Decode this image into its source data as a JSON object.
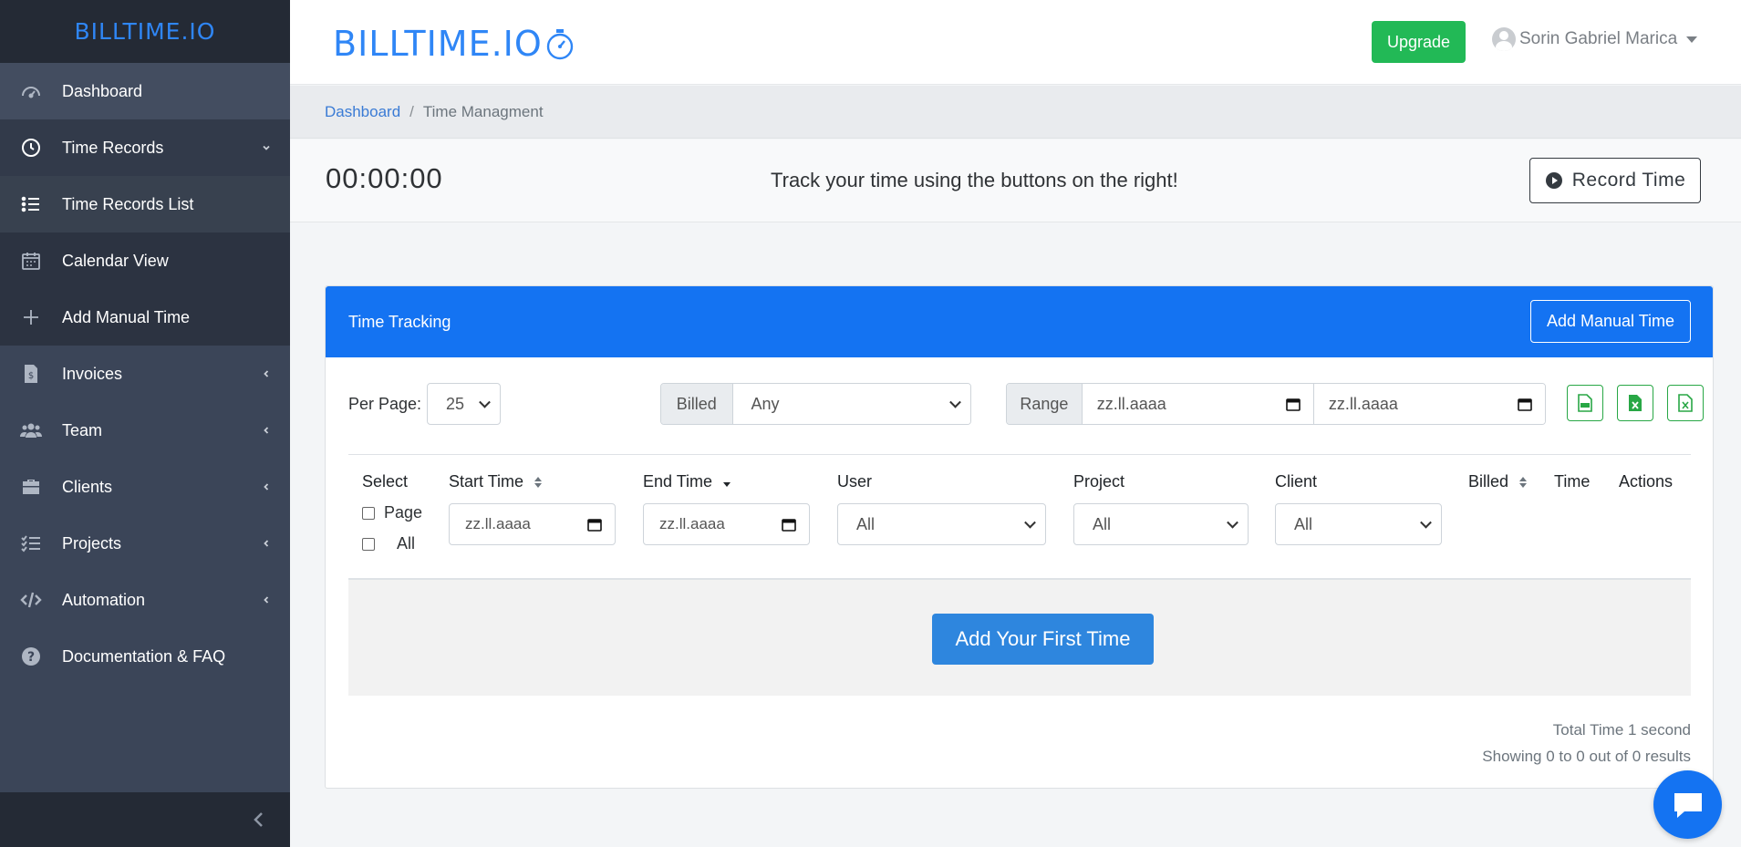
{
  "sidebar": {
    "logo": "BILLTIME.IO",
    "items": [
      {
        "label": "Dashboard",
        "icon": "speedometer-icon"
      },
      {
        "label": "Time Records",
        "icon": "clock-icon"
      },
      {
        "label": "Time Records List",
        "icon": "list-icon"
      },
      {
        "label": "Calendar View",
        "icon": "calendar-icon"
      },
      {
        "label": "Add Manual Time",
        "icon": "plus-icon"
      },
      {
        "label": "Invoices",
        "icon": "invoice-icon"
      },
      {
        "label": "Team",
        "icon": "users-icon"
      },
      {
        "label": "Clients",
        "icon": "briefcase-icon"
      },
      {
        "label": "Projects",
        "icon": "tasks-icon"
      },
      {
        "label": "Automation",
        "icon": "code-icon"
      },
      {
        "label": "Documentation & FAQ",
        "icon": "question-icon"
      }
    ]
  },
  "topbar": {
    "logo": "BILLTIME.IO",
    "upgrade_label": "Upgrade",
    "user_name": "Sorin Gabriel Marica"
  },
  "breadcrumb": {
    "home": "Dashboard",
    "separator": "/",
    "current": "Time Managment"
  },
  "timer": {
    "value": "00:00:00",
    "message": "Track your time using the buttons on the right!",
    "record_label": "Record Time"
  },
  "card": {
    "title": "Time Tracking",
    "add_manual_label": "Add Manual Time",
    "filters": {
      "per_page_label": "Per Page:",
      "per_page_value": "25",
      "billed_label": "Billed",
      "billed_value": "Any",
      "range_label": "Range",
      "range_from": "zz.ll.aaaa",
      "range_to": "zz.ll.aaaa"
    },
    "columns": {
      "select": "Select",
      "select_page": "Page",
      "select_all": "All",
      "start_time": "Start Time",
      "start_placeholder": "zz.ll.aaaa",
      "end_time": "End Time",
      "end_placeholder": "zz.ll.aaaa",
      "user": "User",
      "user_value": "All",
      "project": "Project",
      "project_value": "All",
      "client": "Client",
      "client_value": "All",
      "billed": "Billed",
      "time": "Time",
      "actions": "Actions"
    },
    "empty_button": "Add Your First Time",
    "total_time": "Total Time 1 second",
    "showing": "Showing 0 to 0 out of 0 results"
  },
  "colors": {
    "sidebar_bg": "#3b4558",
    "brand_blue": "#1473f2",
    "upgrade_green": "#22b956",
    "export_green": "#28a745"
  }
}
